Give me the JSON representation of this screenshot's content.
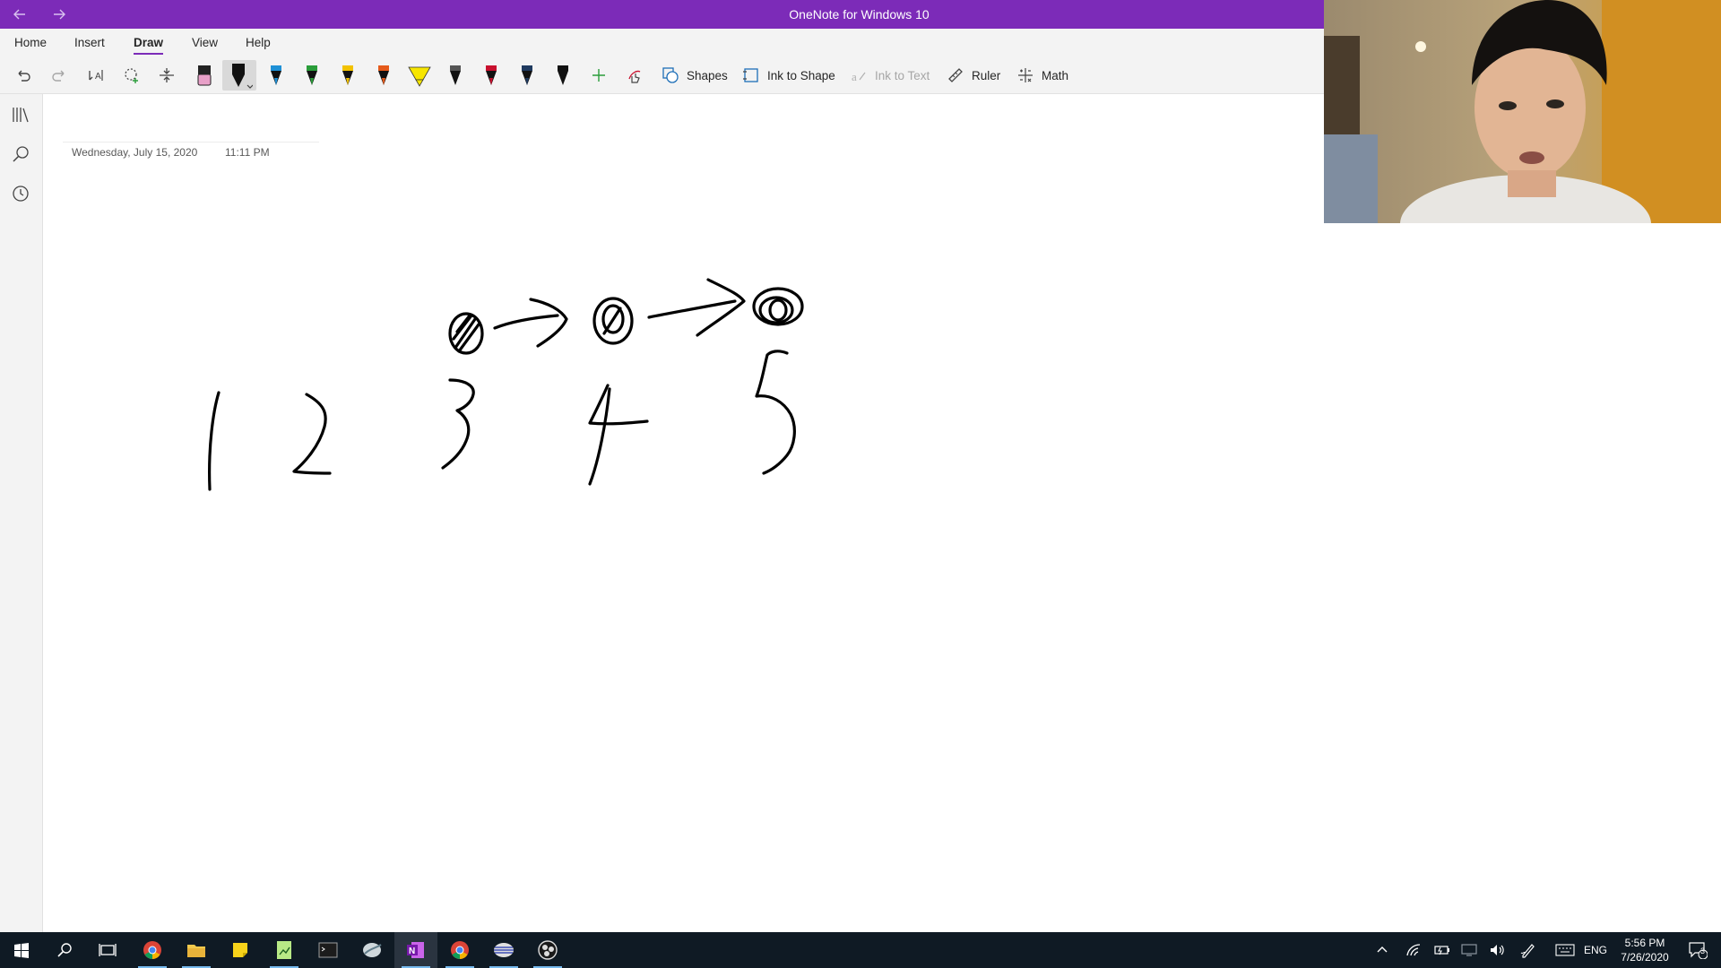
{
  "window": {
    "title": "OneNote for Windows 10",
    "back_icon": "back-arrow-icon",
    "forward_icon": "forward-arrow-icon",
    "accent_color": "#7c2bb8"
  },
  "tabs": [
    {
      "label": "Home"
    },
    {
      "label": "Insert"
    },
    {
      "label": "Draw",
      "active": true
    },
    {
      "label": "View"
    },
    {
      "label": "Help"
    }
  ],
  "toolbar": {
    "undo_icon": "undo-icon",
    "redo_icon": "redo-icon",
    "pens": [
      {
        "name": "eraser",
        "color": "#e8a0c8"
      },
      {
        "name": "black-pen-selected",
        "color": "#000000"
      },
      {
        "name": "blue-pen",
        "color": "#1e90d6"
      },
      {
        "name": "green-pen",
        "color": "#2a9d3a"
      },
      {
        "name": "yellow-pen",
        "color": "#f2c200"
      },
      {
        "name": "orange-pen",
        "color": "#e55a1b"
      },
      {
        "name": "yellow-highlighter",
        "color": "#f7e600"
      },
      {
        "name": "dark-pen-1",
        "color": "#333333"
      },
      {
        "name": "red-pen",
        "color": "#c8102e"
      },
      {
        "name": "navy-pen",
        "color": "#1f3a5f"
      },
      {
        "name": "black-pen",
        "color": "#000000"
      }
    ],
    "shapes_label": "Shapes",
    "ink_to_shape_label": "Ink to Shape",
    "ink_to_text_label": "Ink to Text",
    "ruler_label": "Ruler",
    "math_label": "Math"
  },
  "page": {
    "date": "Wednesday, July 15, 2020",
    "time": "11:11 PM"
  },
  "taskbar": {
    "language": "ENG",
    "clock_time": "5:56 PM",
    "clock_date": "7/26/2020",
    "notification_count": "3"
  }
}
